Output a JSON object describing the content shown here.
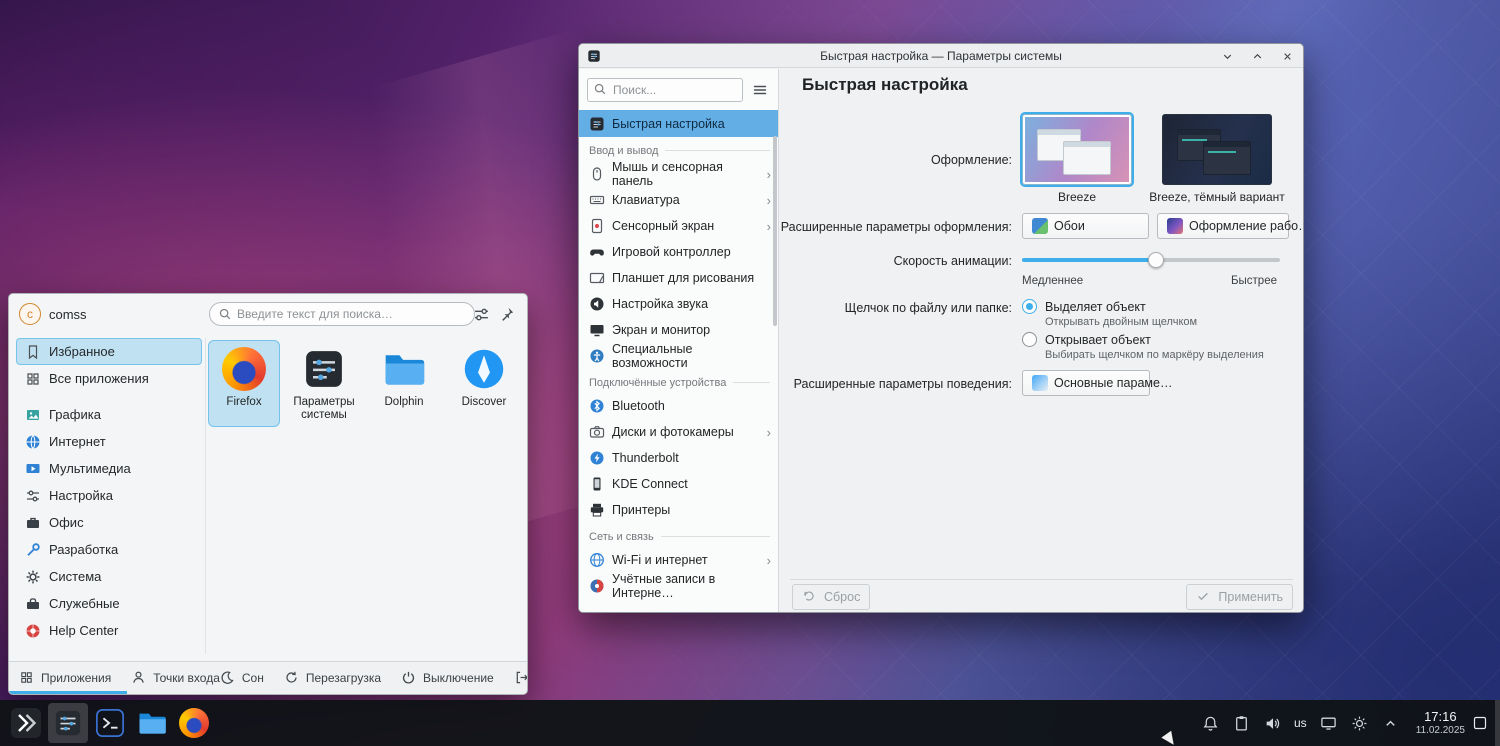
{
  "desktop": {
    "accent_color": "#3daee9"
  },
  "settings_window": {
    "titlebar": {
      "title": "Быстрая настройка — Параметры системы"
    },
    "sidebar": {
      "search_placeholder": "Поиск...",
      "top_item": {
        "label": "Быстрая настройка"
      },
      "groups": [
        {
          "header": "Ввод и вывод",
          "items": [
            {
              "label": "Мышь и сенсорная панель",
              "chevron": true
            },
            {
              "label": "Клавиатура",
              "chevron": true
            },
            {
              "label": "Сенсорный экран",
              "chevron": true
            },
            {
              "label": "Игровой контроллер",
              "chevron": false
            },
            {
              "label": "Планшет для рисования",
              "chevron": false
            },
            {
              "label": "Настройка звука",
              "chevron": false
            },
            {
              "label": "Экран и монитор",
              "chevron": false
            },
            {
              "label": "Специальные возможности",
              "chevron": false
            }
          ]
        },
        {
          "header": "Подключённые устройства",
          "items": [
            {
              "label": "Bluetooth",
              "chevron": false
            },
            {
              "label": "Диски и фотокамеры",
              "chevron": true
            },
            {
              "label": "Thunderbolt",
              "chevron": false
            },
            {
              "label": "KDE Connect",
              "chevron": false
            },
            {
              "label": "Принтеры",
              "chevron": false
            }
          ]
        },
        {
          "header": "Сеть и связь",
          "items": [
            {
              "label": "Wi-Fi и интернет",
              "chevron": true
            },
            {
              "label": "Учётные записи в Интерне…",
              "chevron": false
            }
          ]
        }
      ]
    },
    "main": {
      "title": "Быстрая настройка",
      "appearance": {
        "label": "Оформление:",
        "themes": [
          {
            "name": "Breeze",
            "selected": true
          },
          {
            "name": "Breeze, тёмный вариант",
            "selected": false
          }
        ]
      },
      "appearance_advanced": {
        "label": "Расширенные параметры оформления:",
        "wallpaper_button": "Обои",
        "workspace_button": "Оформление рабо…"
      },
      "animation_speed": {
        "label": "Скорость анимации:",
        "slower": "Медленнее",
        "faster": "Быстрее",
        "value_percent": 52
      },
      "click_behavior": {
        "label": "Щелчок по файлу или папке:",
        "options": [
          {
            "label": "Выделяет объект",
            "description": "Открывать двойным щелчком",
            "selected": true
          },
          {
            "label": "Открывает объект",
            "description": "Выбирать щелчком по маркёру выделения",
            "selected": false
          }
        ]
      },
      "behavior_advanced": {
        "label": "Расширенные параметры поведения:",
        "button": "Основные параме…"
      },
      "footer": {
        "reset": "Сброс",
        "apply": "Применить"
      }
    }
  },
  "launcher": {
    "header": {
      "avatar_letter": "c",
      "username": "comss",
      "search_placeholder": "Введите текст для поиска…"
    },
    "categories": [
      {
        "label": "Избранное",
        "selected": true
      },
      {
        "label": "Все приложения",
        "selected": false
      },
      {
        "label": "Графика",
        "selected": false
      },
      {
        "label": "Интернет",
        "selected": false
      },
      {
        "label": "Мультимедиа",
        "selected": false
      },
      {
        "label": "Настройка",
        "selected": false
      },
      {
        "label": "Офис",
        "selected": false
      },
      {
        "label": "Разработка",
        "selected": false
      },
      {
        "label": "Система",
        "selected": false
      },
      {
        "label": "Служебные",
        "selected": false
      },
      {
        "label": "Help Center",
        "selected": false
      }
    ],
    "favorites": [
      {
        "label": "Firefox",
        "selected": true
      },
      {
        "label": "Параметры системы",
        "selected": false
      },
      {
        "label": "Dolphin",
        "selected": false
      },
      {
        "label": "Discover",
        "selected": false
      }
    ],
    "footer": {
      "tabs": [
        {
          "label": "Приложения",
          "active": true
        },
        {
          "label": "Точки входа",
          "active": false
        }
      ],
      "actions": [
        {
          "label": "Сон"
        },
        {
          "label": "Перезагрузка"
        },
        {
          "label": "Выключение"
        },
        {
          "label": "Выход"
        }
      ]
    }
  },
  "taskbar": {
    "apps": [
      {
        "name": "Application Launcher"
      },
      {
        "name": "System Settings",
        "active": true
      },
      {
        "name": "Konsole"
      },
      {
        "name": "Dolphin"
      },
      {
        "name": "Firefox"
      }
    ],
    "tray": {
      "keyboard_layout": "us",
      "clock_time": "17:16",
      "clock_date": "11.02.2025"
    }
  }
}
